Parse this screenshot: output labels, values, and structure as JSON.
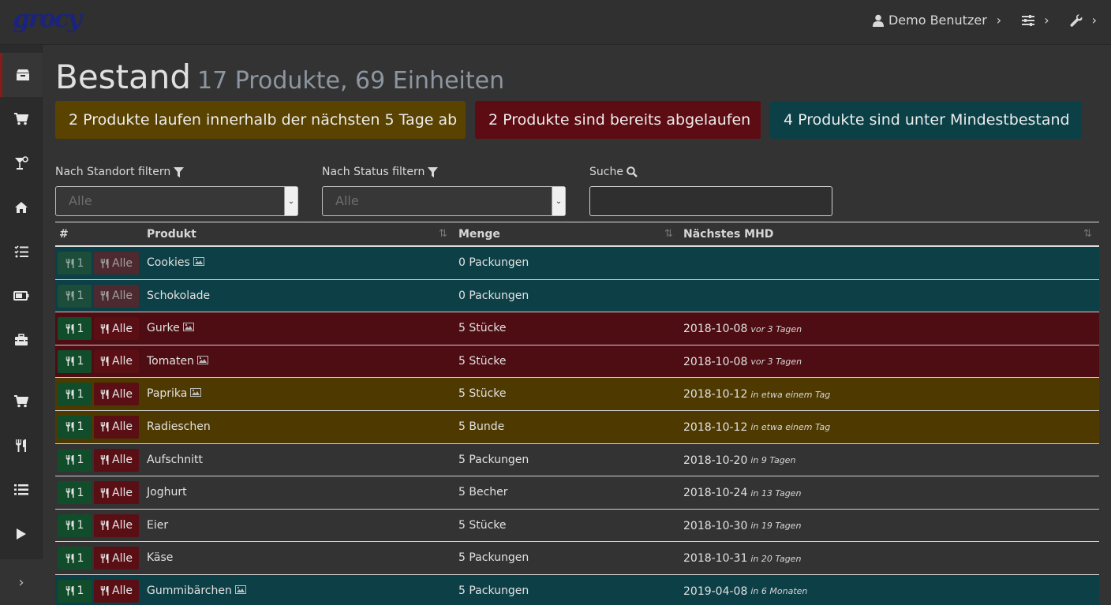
{
  "app": {
    "logo": "grocy"
  },
  "topnav": {
    "user": "Demo Benutzer"
  },
  "page": {
    "title": "Bestand",
    "subtitle": "17 Produkte, 69 Einheiten"
  },
  "alerts": {
    "expiring": "2 Produkte laufen innerhalb der nächsten 5 Tage ab",
    "expired": "2 Produkte sind bereits abgelaufen",
    "below_min": "4 Produkte sind unter Mindestbestand"
  },
  "filters": {
    "location_label": "Nach Standort filtern",
    "location_value": "Alle",
    "status_label": "Nach Status filtern",
    "status_value": "Alle",
    "search_label": "Suche"
  },
  "table": {
    "headers": {
      "num": "#",
      "product": "Produkt",
      "amount": "Menge",
      "bbd": "Nächstes MHD"
    },
    "consume_one_label": "1",
    "consume_all_label": "Alle",
    "rows": [
      {
        "product": "Cookies",
        "amount": "0 Packungen",
        "date": "",
        "relative": "",
        "status": "info",
        "picture": true,
        "dim": true
      },
      {
        "product": "Schokolade",
        "amount": "0 Packungen",
        "date": "",
        "relative": "",
        "status": "info",
        "picture": false,
        "dim": true
      },
      {
        "product": "Gurke",
        "amount": "5 Stücke",
        "date": "2018-10-08",
        "relative": "vor 3 Tagen",
        "status": "danger",
        "picture": true,
        "dim": false
      },
      {
        "product": "Tomaten",
        "amount": "5 Stücke",
        "date": "2018-10-08",
        "relative": "vor 3 Tagen",
        "status": "danger",
        "picture": true,
        "dim": false
      },
      {
        "product": "Paprika",
        "amount": "5 Stücke",
        "date": "2018-10-12",
        "relative": "in etwa einem Tag",
        "status": "warning",
        "picture": true,
        "dim": false
      },
      {
        "product": "Radieschen",
        "amount": "5 Bunde",
        "date": "2018-10-12",
        "relative": "in etwa einem Tag",
        "status": "warning",
        "picture": false,
        "dim": false
      },
      {
        "product": "Aufschnitt",
        "amount": "5 Packungen",
        "date": "2018-10-20",
        "relative": "in 9 Tagen",
        "status": "plain",
        "picture": false,
        "dim": false
      },
      {
        "product": "Joghurt",
        "amount": "5 Becher",
        "date": "2018-10-24",
        "relative": "in 13 Tagen",
        "status": "plain",
        "picture": false,
        "dim": false
      },
      {
        "product": "Eier",
        "amount": "5 Stücke",
        "date": "2018-10-30",
        "relative": "in 19 Tagen",
        "status": "plain",
        "picture": false,
        "dim": false
      },
      {
        "product": "Käse",
        "amount": "5 Packungen",
        "date": "2018-10-31",
        "relative": "in 20 Tagen",
        "status": "plain",
        "picture": false,
        "dim": false
      },
      {
        "product": "Gummibärchen",
        "amount": "5 Packungen",
        "date": "2019-04-08",
        "relative": "in 6 Monaten",
        "status": "info",
        "picture": true,
        "dim": false
      }
    ]
  },
  "sidebar": {
    "items": [
      "box-icon",
      "cart-icon",
      "cocktail-icon",
      "home-icon",
      "tasks-icon",
      "battery-icon",
      "toolbox-icon",
      "cart-icon",
      "utensils-icon",
      "list-icon",
      "play-icon"
    ]
  },
  "colors": {
    "info": "#0c3f46",
    "danger": "#4e0d12",
    "warning": "#4e3a01",
    "background": "#333333",
    "logo": "#1a237e"
  }
}
